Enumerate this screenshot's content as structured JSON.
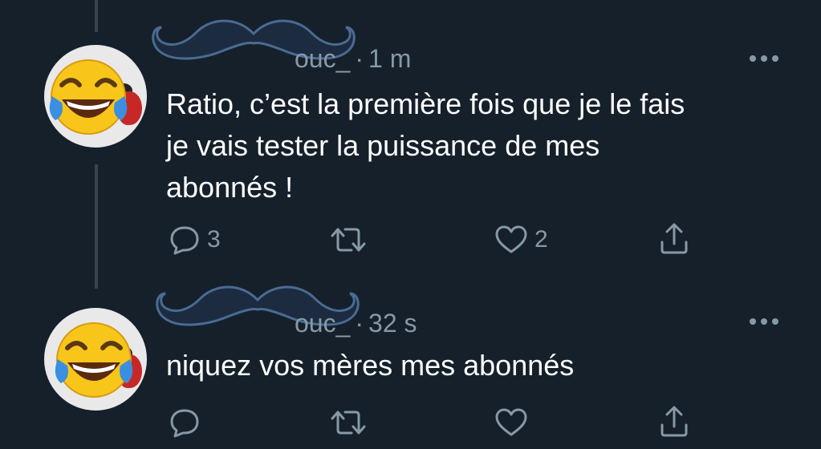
{
  "tweets": [
    {
      "handle": "ouc_",
      "separator": "·",
      "time": "1 m",
      "text_lines": [
        "Ratio, c’est la première fois que je le fais",
        "je vais tester la puissance de mes",
        "abonnés !"
      ],
      "reply_count": "3",
      "retweet_count": "",
      "like_count": "2"
    },
    {
      "handle": "ouc_",
      "separator": "·",
      "time": "32 s",
      "text_lines": [
        "niquez vos mères mes abonnés"
      ],
      "reply_count": "",
      "retweet_count": "",
      "like_count": ""
    }
  ],
  "icons": {
    "avatar_overlay": "face-with-tears-of-joy-icon",
    "name_cover": "mustache-icon",
    "more": "more-icon",
    "reply": "reply-icon",
    "retweet": "retweet-icon",
    "like": "like-icon",
    "share": "share-icon"
  },
  "colors": {
    "background": "#15202b",
    "text": "#ffffff",
    "secondary": "#8899a6",
    "thread_line": "#38444d"
  }
}
